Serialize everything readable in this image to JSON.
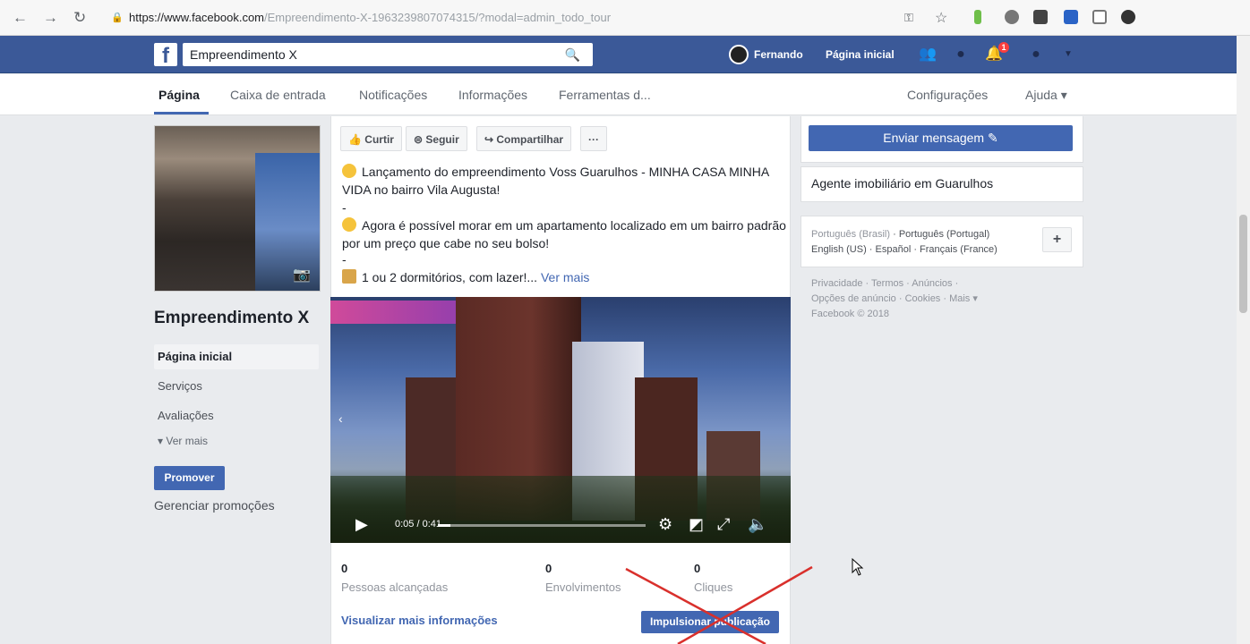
{
  "browser": {
    "url_host": "https://www.facebook.com",
    "url_path": "/Empreendimento-X-1963239807074315/?modal=admin_todo_tour"
  },
  "fb": {
    "logo": "f",
    "search_value": "Empreendimento X",
    "user_name": "Fernando",
    "home_link": "Página inicial",
    "notification_count": "1"
  },
  "page_tabs": [
    "Página",
    "Caixa de entrada",
    "Notificações",
    "Informações",
    "Ferramentas d...",
    "Configurações",
    "Ajuda ▾"
  ],
  "left": {
    "page_name": "Empreendimento X",
    "nav": [
      "Página inicial",
      "Serviços",
      "Avaliações"
    ],
    "see_more": "Ver mais",
    "promote_button": "Promover",
    "manage_promotions": "Gerenciar promoções"
  },
  "post": {
    "actions": [
      "Curtir",
      "Seguir",
      "Compartilhar",
      "···"
    ],
    "line1": "Lançamento do empreendimento Voss Guarulhos - MINHA CASA MINHA VIDA no bairro Vila Augusta!",
    "dash1": "-",
    "line2": "Agora é possível morar em um apartamento localizado em um bairro padrão por um preço que cabe no seu bolso!",
    "dash2": "-",
    "line3": "1 ou 2 dormitórios, com lazer!...",
    "see_more": "Ver mais",
    "video_time": "0:05 / 0:41",
    "video_progress": 0.06,
    "stats": [
      {
        "value": "0",
        "label": "Pessoas alcançadas"
      },
      {
        "value": "0",
        "label": "Envolvimentos"
      },
      {
        "value": "0",
        "label": "Cliques"
      }
    ],
    "more_info": "Visualizar mais informações",
    "boost_button": "Impulsionar publicação"
  },
  "right": {
    "send_message": "Enviar mensagem ✎",
    "category": "Agente imobiliário em Guarulhos",
    "lang_current": "Português (Brasil)",
    "lang_links": "· Português (Portugal)",
    "lang_links2": "English (US) · Español · Français (France)",
    "footer1": "Privacidade · Termos · Anúncios ·",
    "footer2": "Opções de anúncio · Cookies · Mais ▾",
    "footer3": "Facebook © 2018"
  }
}
